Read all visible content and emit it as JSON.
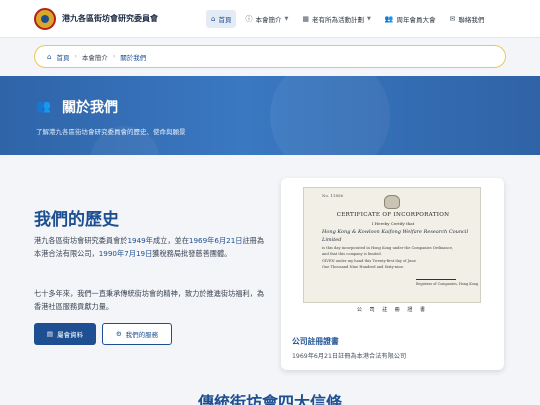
{
  "header": {
    "site_title": "港九各區街坊會研究委員會",
    "nav": [
      {
        "label": "首頁",
        "icon": "home-icon",
        "active": true
      },
      {
        "label": "本會簡介",
        "icon": "info-icon",
        "dropdown": true
      },
      {
        "label": "老有所為活動計劃",
        "icon": "calendar-icon",
        "dropdown": true
      },
      {
        "label": "周年會員大會",
        "icon": "people-icon"
      },
      {
        "label": "聯絡我們",
        "icon": "mail-icon"
      }
    ]
  },
  "breadcrumb": {
    "home": "首頁",
    "parent": "本會簡介",
    "current": "關於我們"
  },
  "hero": {
    "title": "關於我們",
    "subtitle": "了解港九各區街坊會研究委員會的歷史、使命與願景"
  },
  "history": {
    "title": "我們的歷史",
    "p1_a": "港九各區街坊會研究委員會於",
    "p1_b": "1949年",
    "p1_c": "成立，並在",
    "p1_d": "1969年6月21日",
    "p1_e": "註冊為本港合法有限公司，",
    "p1_f": "1990年7月19日",
    "p1_g": "獲稅務局批發慈善團體。",
    "p2": "七十多年來，我們一直秉承傳統街坊會的精神，致力於推進街坊福利，為香港社區服務貢獻力量。",
    "btn_primary": "屬會資料",
    "btn_outline": "我們的服務"
  },
  "certificate_card": {
    "cert_no": "No. 11856",
    "cert_heading": "CERTIFICATE OF INCORPORATION",
    "cert_sub": "I Hereby Certify that",
    "cert_name1": "Hong Kong & Kowloon Kaifong Welfare Research Council",
    "cert_name2": "Limited",
    "cert_line1": "is this day incorporated in Hong Kong under the Companies Ordinance,",
    "cert_line2": "and that this company is limited.",
    "cert_line3": "GIVEN under my hand this Twenty-first day of June",
    "cert_line4": "One Thousand Nine Hundred and Sixty-nine.",
    "cert_registrar": "Registrar of Companies, Hong Kong",
    "cert_stamp": "公 司 註 冊 證 書",
    "title": "公司註冊證書",
    "desc": "1969年6月21日註冊為本港合法有限公司"
  },
  "next_section": {
    "title": "傳統街坊會四大信條"
  },
  "colors": {
    "primary": "#1e4f92",
    "hero_blue": "#3a78c2",
    "breadcrumb_border": "#e8c85a"
  }
}
